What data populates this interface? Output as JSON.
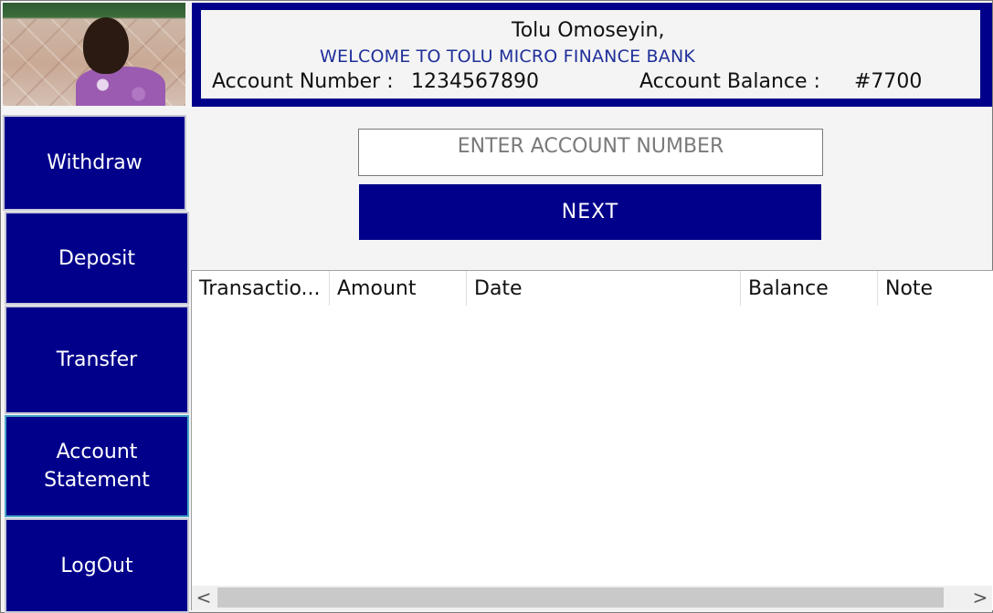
{
  "profile": {
    "photo_alt": "user photo"
  },
  "header": {
    "name": "Tolu Omoseyin,",
    "welcome": "WELCOME TO TOLU MICRO FINANCE BANK",
    "account_number_label": "Account Number :",
    "account_number_value": "1234567890",
    "account_balance_label": "Account Balance :",
    "account_balance_value": "#7700"
  },
  "sidebar": {
    "items": [
      {
        "label": "Withdraw"
      },
      {
        "label": "Deposit"
      },
      {
        "label": "Transfer"
      },
      {
        "label": "Account\nStatement"
      },
      {
        "label": "LogOut"
      }
    ]
  },
  "form": {
    "account_placeholder": "ENTER ACCOUNT NUMBER",
    "next_label": "NEXT"
  },
  "table": {
    "columns": [
      "Transactio...",
      "Amount",
      "Date",
      "Balance",
      "Note"
    ],
    "rows": []
  },
  "scrollbar": {
    "left_arrow": "<",
    "right_arrow": ">"
  }
}
